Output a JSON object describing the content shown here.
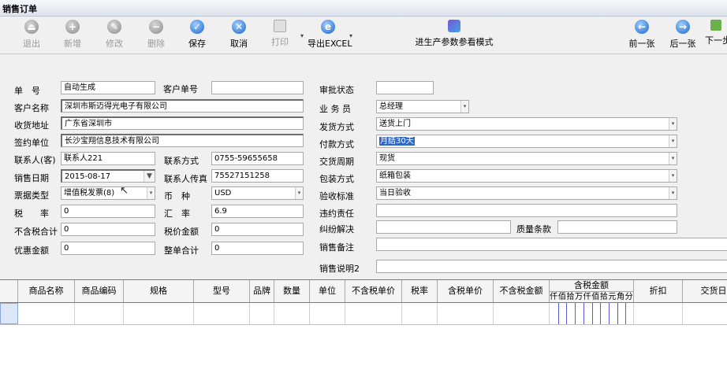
{
  "window": {
    "title": "销售订单"
  },
  "toolbar": {
    "exit": "退出",
    "add": "新增",
    "edit": "修改",
    "delete": "删除",
    "save": "保存",
    "cancel": "取消",
    "print": "打印",
    "export": "导出EXCEL",
    "mode": "进生产参数参看模式",
    "prev": "前一张",
    "next": "后一张",
    "next2": "下一步"
  },
  "form": {
    "order_no": {
      "label": "单　号",
      "value": "自动生成"
    },
    "customer_no": {
      "label": "客户单号",
      "value": ""
    },
    "approval": {
      "label": "审批状态",
      "value": ""
    },
    "customer_name": {
      "label": "客户名称",
      "value": "深圳市斯迈得光电子有限公司"
    },
    "salesman": {
      "label": "业 务 员",
      "value": "总经理"
    },
    "address": {
      "label": "收货地址",
      "value": "广东省深圳市"
    },
    "ship_method": {
      "label": "发货方式",
      "value": "送货上门"
    },
    "sign_unit": {
      "label": "签约单位",
      "value": "长沙宝翔信息技术有限公司"
    },
    "pay_method": {
      "label": "付款方式",
      "value": "月结30天"
    },
    "contact": {
      "label": "联系人(客)",
      "value": "联系人221"
    },
    "contact_method": {
      "label": "联系方式",
      "value": "0755-59655658"
    },
    "delivery_cycle": {
      "label": "交货周期",
      "value": "现货"
    },
    "sale_date": {
      "label": "销售日期",
      "value": "2015-08-17"
    },
    "contact_fax": {
      "label": "联系人传真",
      "value": "75527151258"
    },
    "packing": {
      "label": "包装方式",
      "value": "纸箱包装"
    },
    "invoice_type": {
      "label": "票据类型",
      "value": "增值税发票(8)"
    },
    "currency": {
      "label": "币　种",
      "value": "USD"
    },
    "acceptance": {
      "label": "验收标准",
      "value": "当日验收"
    },
    "tax_rate": {
      "label": "税　　率",
      "value": "0"
    },
    "exchange_rate": {
      "label": "汇　率",
      "value": "6.9"
    },
    "breach": {
      "label": "违约责任",
      "value": ""
    },
    "pretax_total": {
      "label": "不含税合计",
      "value": "0"
    },
    "tax_amount": {
      "label": "税价金额",
      "value": "0"
    },
    "dispute": {
      "label": "纠纷解决",
      "value": ""
    },
    "quality": {
      "label": "质量条款",
      "value": ""
    },
    "discount": {
      "label": "优惠金额",
      "value": "0"
    },
    "total": {
      "label": "整单合计",
      "value": "0"
    },
    "sales_note": {
      "label": "销售备注",
      "value": ""
    },
    "sales_desc": {
      "label": "销售说明2",
      "value": ""
    }
  },
  "grid": {
    "columns": [
      "商品名称",
      "商品编码",
      "规格",
      "型号",
      "品牌",
      "数量",
      "单位",
      "不含税单价",
      "税率",
      "含税单价",
      "不含税金额",
      "含税金额",
      "折扣",
      "交货日"
    ],
    "amount_digits": [
      "仟",
      "佰",
      "拾",
      "万",
      "仟",
      "佰",
      "拾",
      "元",
      "角",
      "分"
    ]
  }
}
